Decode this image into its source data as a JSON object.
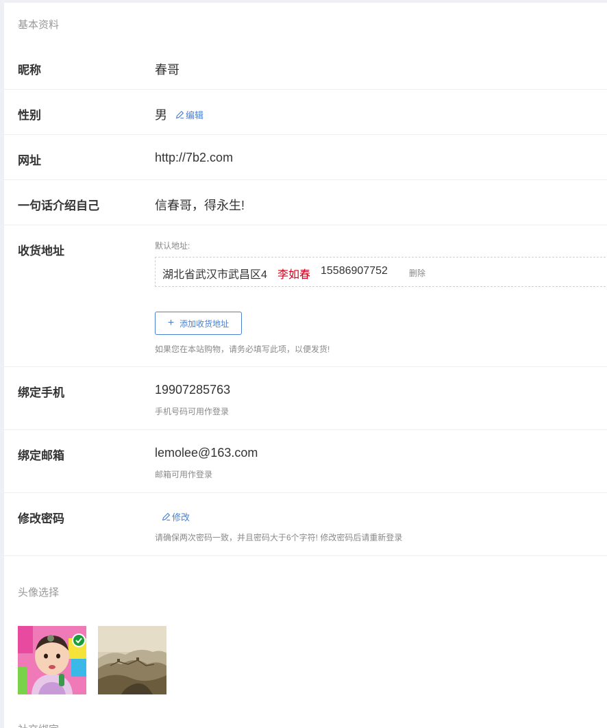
{
  "basic_section": {
    "title": "基本资料"
  },
  "nickname": {
    "label": "昵称",
    "value": "春哥"
  },
  "gender": {
    "label": "性别",
    "value": "男",
    "edit_label": "编辑"
  },
  "website": {
    "label": "网址",
    "value": "http://7b2.com"
  },
  "bio": {
    "label": "一句话介绍自己",
    "value": "信春哥，得永生!"
  },
  "address": {
    "label": "收货地址",
    "default_label": "默认地址:",
    "entry": {
      "location": "湖北省武汉市武昌区4",
      "name": "李如春",
      "phone": "15586907752",
      "delete_label": "删除"
    },
    "add_button": "添加收货地址",
    "hint": "如果您在本站购物，请务必填写此项，以便发货!"
  },
  "phone": {
    "label": "绑定手机",
    "value": "19907285763",
    "hint": "手机号码可用作登录"
  },
  "email": {
    "label": "绑定邮箱",
    "value": "lemolee@163.com",
    "hint": "邮箱可用作登录"
  },
  "password": {
    "label": "修改密码",
    "edit_label": "修改",
    "hint": "请确保两次密码一致，并且密码大于6个字符! 修改密码后请重新登录"
  },
  "avatar_section": {
    "title": "头像选择",
    "avatars": [
      {
        "name": "baby-photo",
        "selected": true
      },
      {
        "name": "great-wall-photo",
        "selected": false
      }
    ]
  },
  "social_section": {
    "title": "社交绑定"
  },
  "colors": {
    "accent": "#4a7fd1",
    "name_red": "#d0021b",
    "check_green": "#1a9e3a"
  }
}
